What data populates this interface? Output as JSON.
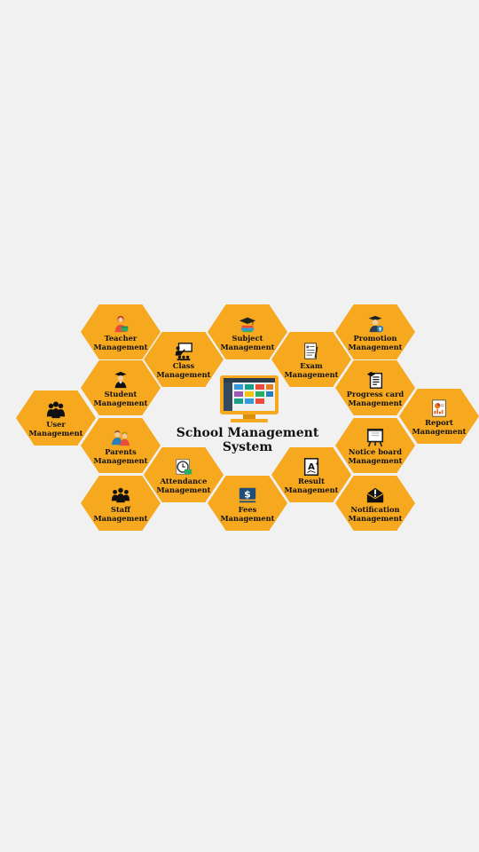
{
  "center": {
    "title_line1": "School Management",
    "title_line2": "System"
  },
  "modules": [
    {
      "key": "teacher",
      "line1": "Teacher",
      "line2": "Management",
      "icon": "teacher-icon"
    },
    {
      "key": "subject",
      "line1": "Subject",
      "line2": "Management",
      "icon": "graduation-cap-books-icon"
    },
    {
      "key": "promotion",
      "line1": "Promotion",
      "line2": "Management",
      "icon": "graduate-upload-icon"
    },
    {
      "key": "class",
      "line1": "Class",
      "line2": "Management",
      "icon": "classroom-board-icon"
    },
    {
      "key": "exam",
      "line1": "Exam",
      "line2": "Management",
      "icon": "exam-sheet-icon"
    },
    {
      "key": "student",
      "line1": "Student",
      "line2": "Management",
      "icon": "student-icon"
    },
    {
      "key": "progress",
      "line1": "Progress card",
      "line2": "Management",
      "icon": "progress-card-icon"
    },
    {
      "key": "user",
      "line1": "User",
      "line2": "Management",
      "icon": "users-group-icon"
    },
    {
      "key": "report",
      "line1": "Report",
      "line2": "Management",
      "icon": "report-chart-icon"
    },
    {
      "key": "parents",
      "line1": "Parents",
      "line2": "Management",
      "icon": "parents-icon"
    },
    {
      "key": "notice",
      "line1": "Notice board",
      "line2": "Management",
      "icon": "notice-board-icon"
    },
    {
      "key": "attendance",
      "line1": "Attendance",
      "line2": "Management",
      "icon": "attendance-clock-icon"
    },
    {
      "key": "result",
      "line1": "Result",
      "line2": "Management",
      "icon": "result-grade-icon"
    },
    {
      "key": "staff",
      "line1": "Staff",
      "line2": "Management",
      "icon": "staff-group-icon"
    },
    {
      "key": "fees",
      "line1": "Fees",
      "line2": "Management",
      "icon": "fees-dollar-icon"
    },
    {
      "key": "notification",
      "line1": "Notification",
      "line2": "Management",
      "icon": "notification-envelope-icon"
    }
  ],
  "colors": {
    "hex_fill": "#f6a81e",
    "background": "#f1f1f1",
    "text": "#111111",
    "monitor_bezel": "#f6a81e",
    "monitor_screen": "#2a3a4a"
  }
}
